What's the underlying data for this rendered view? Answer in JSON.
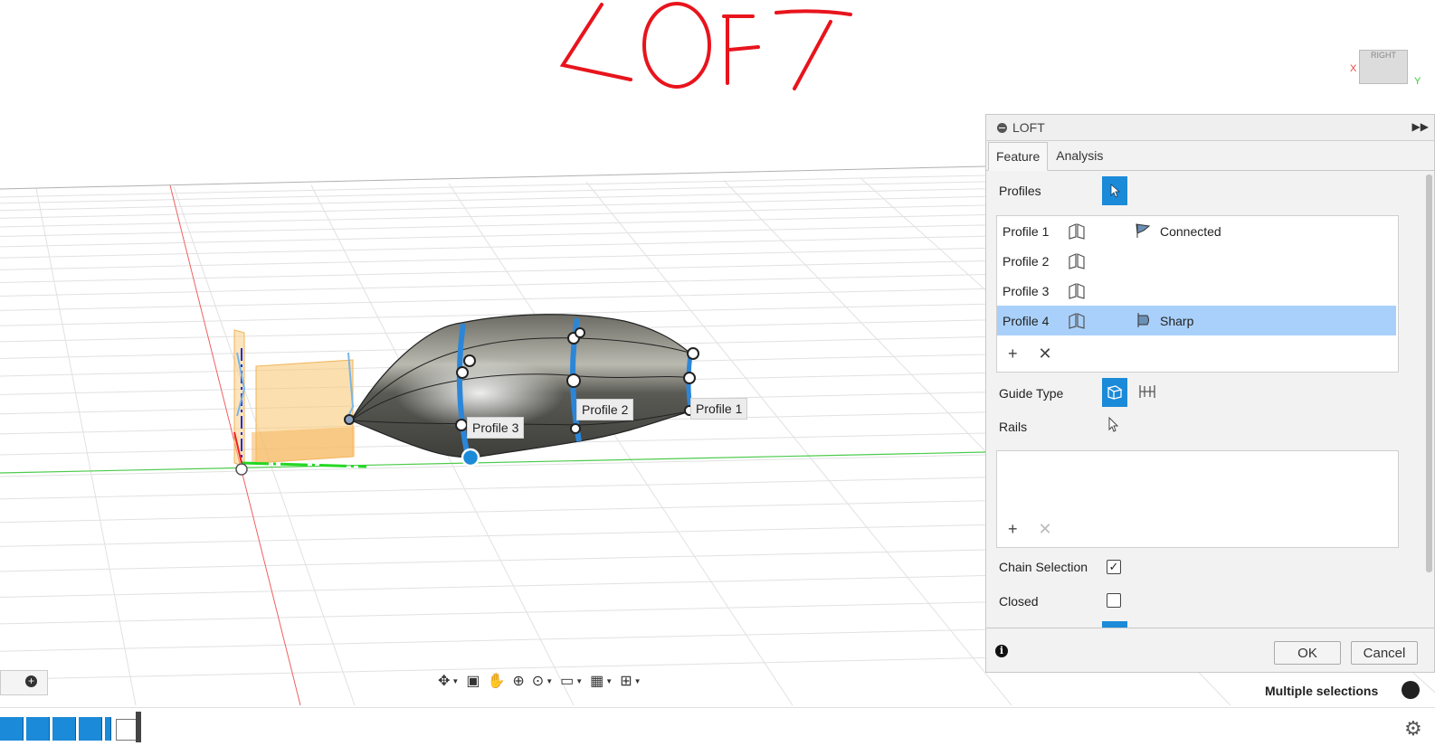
{
  "annotation": {
    "text": "LOFT",
    "color": "#e8141c"
  },
  "viewport": {
    "profile_labels": [
      "Profile 3",
      "Profile 2",
      "Profile 1"
    ],
    "viewcube_label": "RIGHT",
    "axis_labels": {
      "x": "X",
      "y": "Y"
    }
  },
  "panel": {
    "title": "LOFT",
    "tabs": [
      {
        "label": "Feature"
      },
      {
        "label": "Analysis"
      }
    ],
    "profiles_label": "Profiles",
    "profiles": [
      {
        "name": "Profile 1",
        "condition": "Connected"
      },
      {
        "name": "Profile 2",
        "condition": ""
      },
      {
        "name": "Profile 3",
        "condition": ""
      },
      {
        "name": "Profile 4",
        "condition": "Sharp"
      }
    ],
    "guide_type_label": "Guide Type",
    "rails_label": "Rails",
    "chain_selection_label": "Chain Selection",
    "chain_selection_checked": true,
    "closed_label": "Closed",
    "closed_checked": false,
    "ok_label": "OK",
    "cancel_label": "Cancel"
  },
  "status": {
    "text": "Multiple selections"
  },
  "colors": {
    "accent": "#1b8ad8",
    "selected_row": "#a9d0fb",
    "sketch_fill": "#f9c97a"
  }
}
